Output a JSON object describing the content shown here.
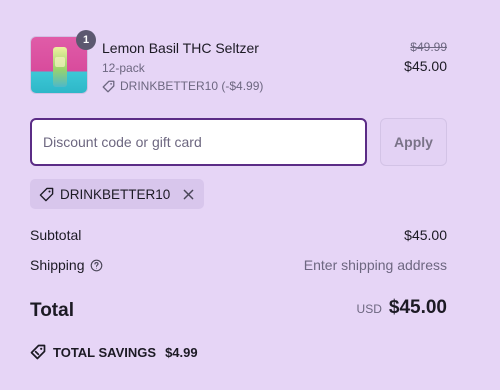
{
  "cart": {
    "item": {
      "quantity": "1",
      "name": "Lemon Basil THC Seltzer",
      "variant": "12-pack",
      "discount": "DRINKBETTER10 (-$4.99)",
      "compare_price": "$49.99",
      "price": "$45.00"
    }
  },
  "discount": {
    "placeholder": "Discount code or gift card",
    "value": "",
    "apply_label": "Apply",
    "applied_code": "DRINKBETTER10"
  },
  "totals": {
    "subtotal_label": "Subtotal",
    "subtotal_value": "$45.00",
    "shipping_label": "Shipping",
    "shipping_value": "Enter shipping address",
    "total_label": "Total",
    "currency": "USD",
    "total_value": "$45.00",
    "savings_label": "TOTAL SAVINGS",
    "savings_value": "$4.99"
  },
  "colors": {
    "background": "#e6d5f6",
    "input_border": "#5b2c86",
    "tag_background": "#d8c6ec",
    "badge": "#5c5870"
  },
  "icons": [
    "tag-icon",
    "close-icon",
    "help-icon",
    "savings-tag-icon"
  ]
}
